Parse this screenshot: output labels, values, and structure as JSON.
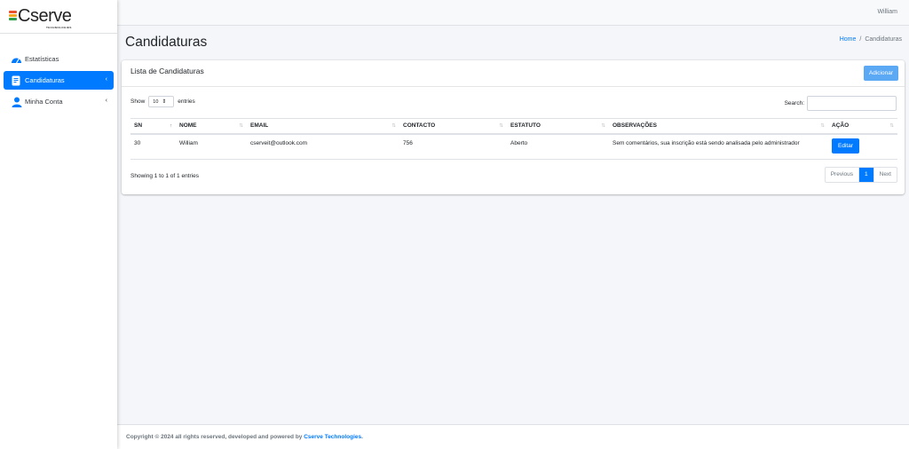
{
  "brand": {
    "name": "Cserve",
    "tagline": "TECHNOLOGIES",
    "bar_colors": [
      "#e8502e",
      "#f5a623",
      "#2e9e4a"
    ]
  },
  "topbar": {
    "user": "William"
  },
  "sidebar": {
    "items": [
      {
        "label": "Estatísticas",
        "icon": "gauge-icon",
        "active": false
      },
      {
        "label": "Candidaturas",
        "icon": "document-icon",
        "active": true,
        "chevron": "‹"
      },
      {
        "label": "Minha Conta",
        "icon": "user-icon",
        "active": false,
        "chevron": "‹"
      }
    ]
  },
  "header": {
    "title": "Candidaturas",
    "breadcrumb": {
      "home": "Home",
      "separator": "/",
      "current": "Candidaturas"
    }
  },
  "card": {
    "title": "Lista de Candidaturas",
    "add_label": "Adicionar",
    "length": {
      "prefix": "Show",
      "value": "10",
      "suffix": "entries"
    },
    "search_label": "Search:",
    "columns": [
      "SN",
      "NOME",
      "EMAIL",
      "CONTACTO",
      "ESTATUTO",
      "OBSERVAÇÕES",
      "AÇÃO"
    ],
    "rows": [
      {
        "sn": "30",
        "nome": "William",
        "email": "cserveit@outlook.com",
        "contacto": "756",
        "estatuto": "Aberto",
        "observacoes": "Sem comentários, sua inscrição está sendo analisada pelo administrador",
        "acao": "Editar"
      }
    ],
    "info": "Showing 1 to 1 of 1 entries",
    "pagination": {
      "previous": "Previous",
      "current": "1",
      "next": "Next"
    }
  },
  "footer": {
    "text": "Copyright © 2024 all rights reserved, developed and powered by",
    "company": "Cserve Technologies",
    "end": "."
  },
  "colors": {
    "primary": "#007bff",
    "add_button": "#5ba8f5",
    "background": "#f4f6f9"
  }
}
